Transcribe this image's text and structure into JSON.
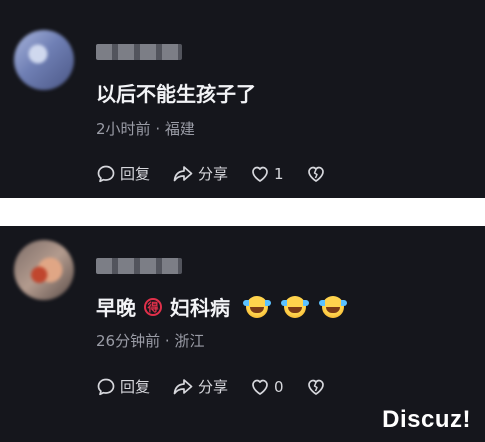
{
  "comments": [
    {
      "content": "以后不能生孩子了",
      "time": "2小时前",
      "separator": "·",
      "location": "福建",
      "reply_label": "回复",
      "share_label": "分享",
      "like_count": "1"
    },
    {
      "content_prefix": "早晚",
      "sticker_text": "得",
      "content_suffix": "妇科病",
      "time": "26分钟前",
      "separator": "·",
      "location": "浙江",
      "reply_label": "回复",
      "share_label": "分享",
      "like_count": "0"
    }
  ],
  "watermark": "Discuz!",
  "colors": {
    "card_bg": "#15161c",
    "meta_text": "#9a9ca6",
    "sticker_red": "#e0304a"
  },
  "icons": [
    "comment-bubble-icon",
    "share-arrow-icon",
    "heart-icon",
    "broken-heart-icon",
    "laughing-crying-emoji"
  ]
}
